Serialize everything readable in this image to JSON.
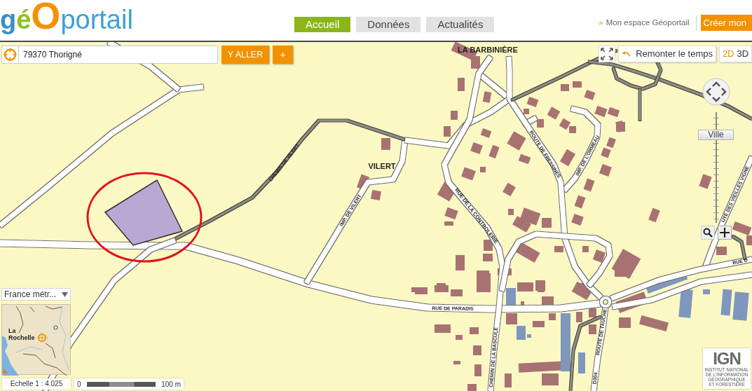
{
  "header": {
    "logo": [
      {
        "text": "g",
        "kind": "initial"
      },
      {
        "text": "é",
        "kind": "accent"
      },
      {
        "text": "O",
        "kind": "big"
      },
      {
        "text": "portail",
        "kind": "word"
      }
    ],
    "nav_tabs": [
      {
        "label": "Accueil",
        "selected": true
      },
      {
        "label": "Données",
        "selected": false
      },
      {
        "label": "Actualités",
        "selected": false
      }
    ],
    "account_link": {
      "marker": "»",
      "label": "Mon espace Géoportail"
    },
    "signup_button": "Créer mon"
  },
  "search": {
    "value": "79370 Thorigné",
    "go_button": "Y ALLER",
    "add_button": "+"
  },
  "map_tools": {
    "history_button": "Remonter le temps",
    "view_modes": [
      {
        "label": "2D",
        "selected": true
      },
      {
        "label": "3D",
        "selected": false
      }
    ],
    "zoom_preset": "Ville"
  },
  "map": {
    "labels": [
      {
        "text": "LA BARBINIÈRE",
        "kind": "place"
      },
      {
        "text": "VILERT",
        "kind": "place"
      },
      {
        "text": "CHEMIN DE VILERT",
        "kind": "street"
      },
      {
        "text": "IMP. DE VILERT",
        "kind": "street"
      },
      {
        "text": "RUE DE LA CONTROLERIE",
        "kind": "street"
      },
      {
        "text": "ROUTE DE FRESSINES",
        "kind": "street"
      },
      {
        "text": "IMP. DE L'ORMEAU",
        "kind": "street"
      },
      {
        "text": "UTE DES VIEILLES VIGNE",
        "kind": "street"
      },
      {
        "text": "RUE D",
        "kind": "street"
      },
      {
        "text": "RUE DE PARADIS",
        "kind": "street"
      },
      {
        "text": "CHEMIN DE LA BASCULE",
        "kind": "street"
      },
      {
        "text": "ROUTE DE TAUCHE",
        "kind": "street"
      },
      {
        "text": "D304",
        "kind": "street"
      }
    ]
  },
  "overview": {
    "region_select": "France métr...",
    "city": "La Rochelle"
  },
  "scale": {
    "ratio": "Echelle 1 : 4.025",
    "start": "0",
    "end": "100 m"
  },
  "ign_logo": {
    "wordmark": "IGN",
    "name_lines": [
      "INSTITUT NATIONAL",
      "DE L'INFORMATION",
      "GÉOGRAPHIQUE",
      "ET FORESTIÈRE"
    ]
  }
}
